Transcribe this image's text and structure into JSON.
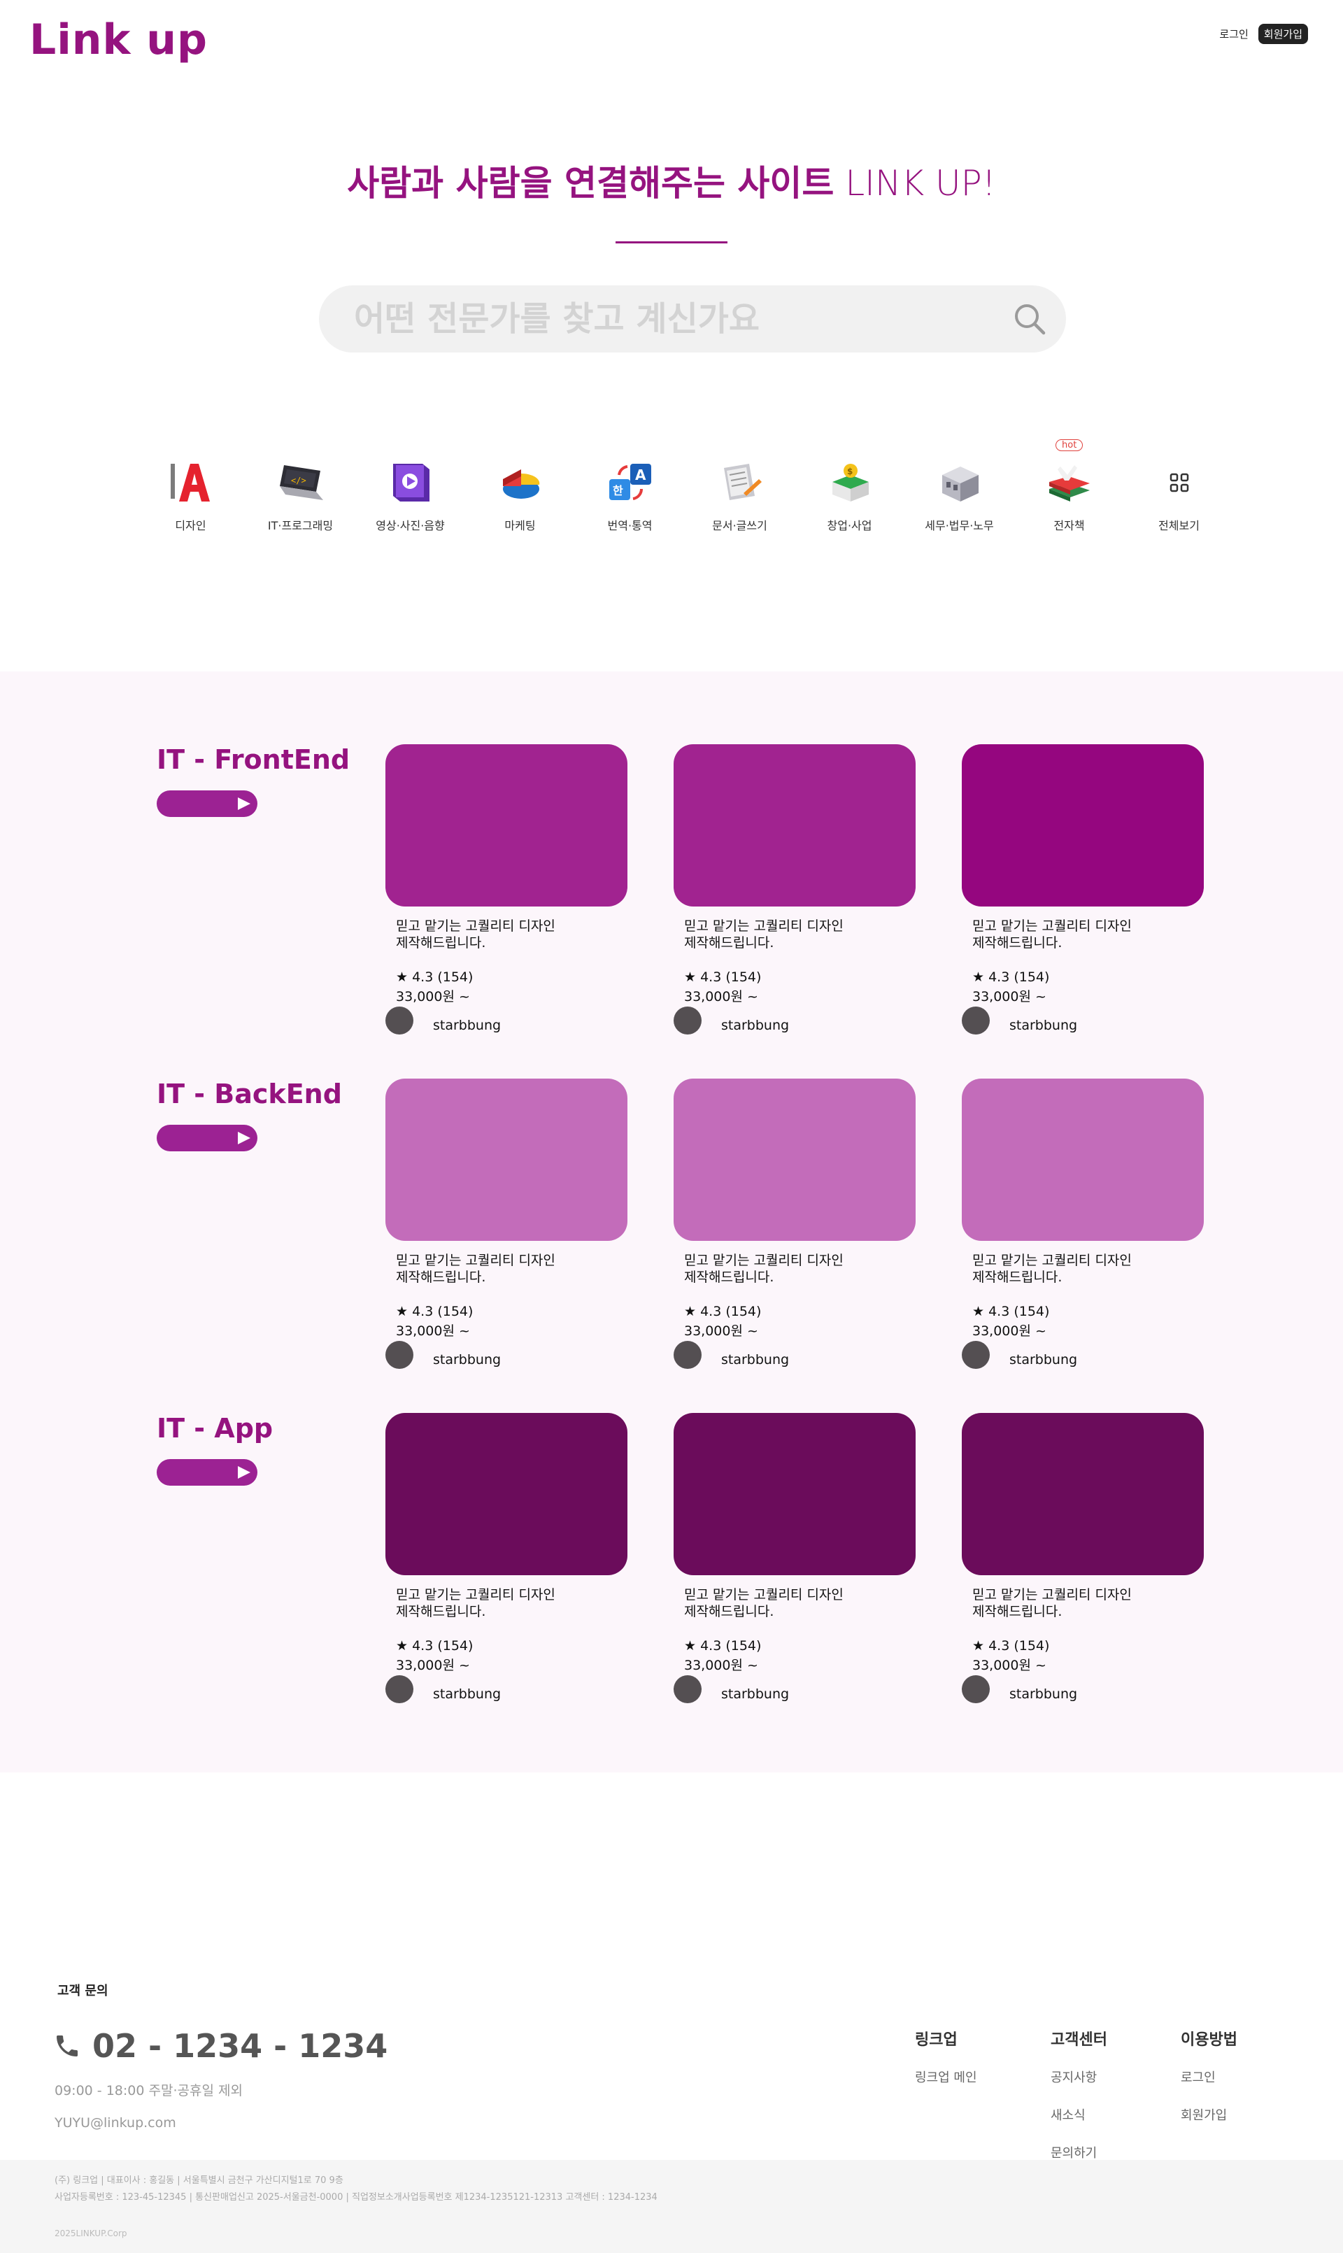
{
  "header": {
    "logo": "Link up",
    "login": "로그인",
    "signup": "회원가입"
  },
  "hero": {
    "title_bold": "사람과 사람을 연결해주는 사이트",
    "title_light": "LINK UP!",
    "search_placeholder": "어떤 전문가를 찾고 계신가요"
  },
  "categories": [
    {
      "label": "디자인",
      "icon": "design-icon"
    },
    {
      "label": "IT·프로그래밍",
      "icon": "laptop-code-icon"
    },
    {
      "label": "영상·사진·음향",
      "icon": "video-icon"
    },
    {
      "label": "마케팅",
      "icon": "pie-chart-icon"
    },
    {
      "label": "번역·통역",
      "icon": "translate-icon"
    },
    {
      "label": "문서·글쓰기",
      "icon": "document-icon"
    },
    {
      "label": "창업·사업",
      "icon": "store-icon"
    },
    {
      "label": "세무·법무·노무",
      "icon": "building-icon"
    },
    {
      "label": "전자책",
      "icon": "ebook-icon",
      "badge": "hot"
    },
    {
      "label": "전체보기",
      "icon": "grid-icon"
    }
  ],
  "rows": [
    {
      "title": "IT - FrontEnd",
      "thumb_colors": [
        "#a12390",
        "#a12390",
        "#95067f"
      ],
      "cards": [
        {
          "desc": "믿고 맡기는 고퀄리티 디자인\n제작해드립니다.",
          "rating": "★ 4.3 (154)",
          "price": "33,000원 ~",
          "seller": "starbbung"
        },
        {
          "desc": "믿고 맡기는 고퀄리티 디자인\n제작해드립니다.",
          "rating": "★ 4.3 (154)",
          "price": "33,000원 ~",
          "seller": "starbbung"
        },
        {
          "desc": "믿고 맡기는 고퀄리티 디자인\n제작해드립니다.",
          "rating": "★ 4.3 (154)",
          "price": "33,000원 ~",
          "seller": "starbbung"
        }
      ]
    },
    {
      "title": "IT - BackEnd",
      "thumb_colors": [
        "#c36cba",
        "#c36cba",
        "#c36cba"
      ],
      "cards": [
        {
          "desc": "믿고 맡기는 고퀄리티 디자인\n제작해드립니다.",
          "rating": "★ 4.3 (154)",
          "price": "33,000원 ~",
          "seller": "starbbung"
        },
        {
          "desc": "믿고 맡기는 고퀄리티 디자인\n제작해드립니다.",
          "rating": "★ 4.3 (154)",
          "price": "33,000원 ~",
          "seller": "starbbung"
        },
        {
          "desc": "믿고 맡기는 고퀄리티 디자인\n제작해드립니다.",
          "rating": "★ 4.3 (154)",
          "price": "33,000원 ~",
          "seller": "starbbung"
        }
      ]
    },
    {
      "title": "IT - App",
      "thumb_colors": [
        "#6b0c5b",
        "#6b0c5b",
        "#6b0c5b"
      ],
      "cards": [
        {
          "desc": "믿고 맡기는 고퀄리티 디자인\n제작해드립니다.",
          "rating": "★ 4.3 (154)",
          "price": "33,000원 ~",
          "seller": "starbbung"
        },
        {
          "desc": "믿고 맡기는 고퀄리티 디자인\n제작해드립니다.",
          "rating": "★ 4.3 (154)",
          "price": "33,000원 ~",
          "seller": "starbbung"
        },
        {
          "desc": "믿고 맡기는 고퀄리티 디자인\n제작해드립니다.",
          "rating": "★ 4.3 (154)",
          "price": "33,000원 ~",
          "seller": "starbbung"
        }
      ]
    }
  ],
  "footer": {
    "cs_title": "고객 문의",
    "phone": "02 - 1234 - 1234",
    "hours": "09:00 - 18:00 주말·공휴일 제외",
    "email": "YUYU@linkup.com",
    "columns": [
      {
        "heading": "링크업",
        "links": [
          "링크업 메인"
        ]
      },
      {
        "heading": "고객센터",
        "links": [
          "공지사항",
          "새소식",
          "문의하기"
        ]
      },
      {
        "heading": "이용방법",
        "links": [
          "로그인",
          "회원가입"
        ]
      }
    ],
    "company_line1": "(주) 링크업 | 대표이사 : 홍길동 | 서울특별시 금천구 가산디지털1로 70 9층",
    "company_line2": "사업자등록번호 : 123-45-12345 | 통신판매업신고 2025-서울금천-0000 | 직업정보소개사업등록번호 제1234-1235121-12313 고객센터 : 1234-1234",
    "copyright": "2025LINKUP.Corp"
  },
  "colors": {
    "brand": "#95137f",
    "section_bg": "#fcf6fb"
  }
}
